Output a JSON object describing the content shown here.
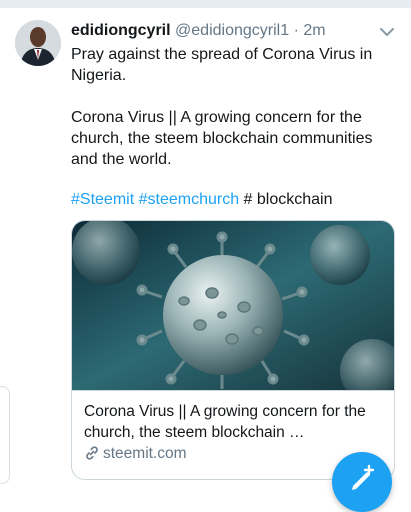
{
  "tweet": {
    "author_name": "edidiongcyril",
    "author_handle": "@edidiongcyril1",
    "separator": "·",
    "time": "2m",
    "line1": "Pray against the spread of Corona Virus in Nigeria.",
    "line2": "Corona Virus || A growing concern for the church, the steem blockchain communities and the world.",
    "hashtags": [
      "#Steemit",
      "#steemchurch"
    ],
    "tag_tail": "# blockchain"
  },
  "card": {
    "title_line1": "Corona Virus || A growing concern for the",
    "title_line2": "church, the steem blockchain …",
    "domain": "steemit.com"
  },
  "icons": {
    "caret": "chevron-down-icon",
    "link": "link-icon",
    "compose": "compose-tweet-icon"
  },
  "colors": {
    "accent": "#1da1f2",
    "text": "#14171a",
    "muted": "#657786",
    "border": "#ccd6dd"
  }
}
